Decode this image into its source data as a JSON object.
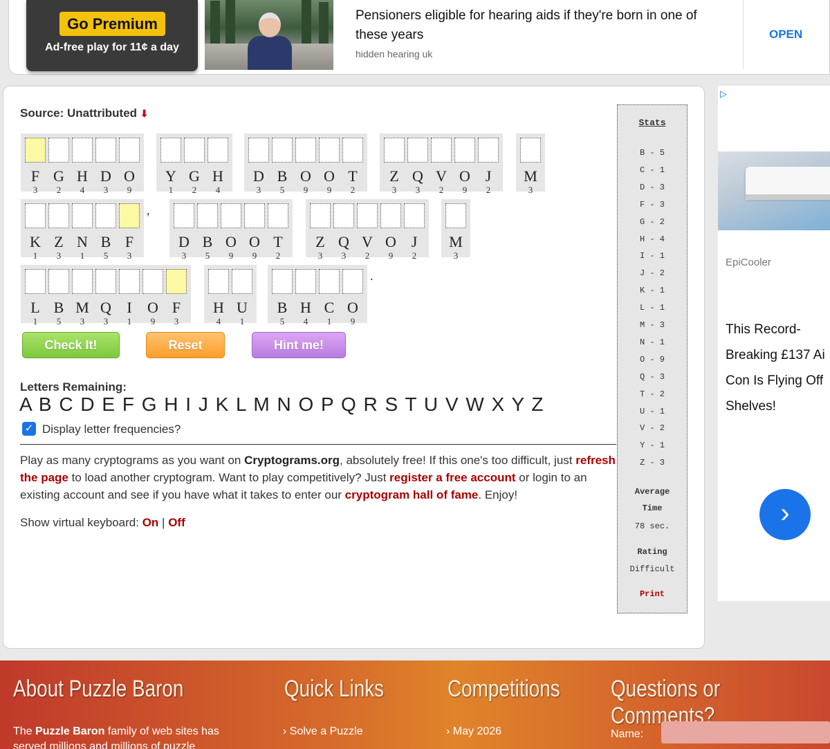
{
  "top_ad": {
    "premium_button": "Go Premium",
    "premium_sub": "Ad-free play for 11¢ a day",
    "headline": "Pensioners eligible for hearing aids if they're born in one of these years",
    "source": "hidden hearing uk",
    "open_label": "OPEN"
  },
  "puzzle": {
    "source_label": "Source: Unattributed",
    "source_arrow": "⬇",
    "rows": [
      [
        {
          "letters": [
            "F",
            "G",
            "H",
            "D",
            "O"
          ],
          "counts": [
            "3",
            "2",
            "4",
            "3",
            "9"
          ],
          "highlight": [
            0
          ]
        },
        {
          "letters": [
            "Y",
            "G",
            "H"
          ],
          "counts": [
            "1",
            "2",
            "4"
          ],
          "highlight": []
        },
        {
          "letters": [
            "D",
            "B",
            "O",
            "O",
            "T"
          ],
          "counts": [
            "3",
            "5",
            "9",
            "9",
            "2"
          ],
          "highlight": []
        },
        {
          "letters": [
            "Z",
            "Q",
            "V",
            "O",
            "J"
          ],
          "counts": [
            "3",
            "3",
            "2",
            "9",
            "2"
          ],
          "highlight": []
        },
        {
          "letters": [
            "M"
          ],
          "counts": [
            "3"
          ],
          "highlight": []
        }
      ],
      [
        {
          "letters": [
            "K",
            "Z",
            "N",
            "B",
            "F"
          ],
          "counts": [
            "1",
            "3",
            "1",
            "5",
            "3"
          ],
          "highlight": [
            4
          ],
          "punct": ","
        },
        {
          "letters": [
            "D",
            "B",
            "O",
            "O",
            "T"
          ],
          "counts": [
            "3",
            "5",
            "9",
            "9",
            "2"
          ],
          "highlight": []
        },
        {
          "letters": [
            "Z",
            "Q",
            "V",
            "O",
            "J"
          ],
          "counts": [
            "3",
            "3",
            "2",
            "9",
            "2"
          ],
          "highlight": []
        },
        {
          "letters": [
            "M"
          ],
          "counts": [
            "3"
          ],
          "highlight": []
        }
      ],
      [
        {
          "letters": [
            "L",
            "B",
            "M",
            "Q",
            "I",
            "O",
            "F"
          ],
          "counts": [
            "1",
            "5",
            "3",
            "3",
            "1",
            "9",
            "3"
          ],
          "highlight": [
            6
          ]
        },
        {
          "letters": [
            "H",
            "U"
          ],
          "counts": [
            "4",
            "1"
          ],
          "highlight": []
        },
        {
          "letters": [
            "B",
            "H",
            "C",
            "O"
          ],
          "counts": [
            "5",
            "4",
            "1",
            "9"
          ],
          "highlight": [],
          "punct": "."
        }
      ]
    ],
    "buttons": {
      "check": "Check It!",
      "reset": "Reset",
      "hint": "Hint me!"
    },
    "letters_remaining_label": "Letters Remaining:",
    "letters_remaining": "A B C D E F G H I J K L M N O P Q R S T U V W X Y Z",
    "display_freq_label": "Display letter frequencies?",
    "display_freq_checked": true
  },
  "info": {
    "p1": "Play as many cryptograms as you want on ",
    "site": "Cryptograms.org",
    "p2": ", absolutely free! If this one's too difficult, just ",
    "link_refresh": "refresh the page",
    "p3": " to load another cryptogram. Want to play competitively? Just ",
    "link_register": "register a free account",
    "p4": " or login to an existing account and see if you have what it takes to enter our ",
    "link_hof": "cryptogram hall of fame",
    "p5": ". Enjoy!",
    "vk_label": "Show virtual keyboard: ",
    "vk_on": "On",
    "vk_sep": " | ",
    "vk_off": "Off"
  },
  "stats": {
    "title": "Stats",
    "rows": [
      "B - 5",
      "C - 1",
      "D - 3",
      "F - 3",
      "G - 2",
      "H - 4",
      "I - 1",
      "J - 2",
      "K - 1",
      "L - 1",
      "M - 3",
      "N - 1",
      "O - 9",
      "Q - 3",
      "T - 2",
      "U - 1",
      "V - 2",
      "Y - 1",
      "Z - 3"
    ],
    "avg_label_1": "Average",
    "avg_label_2": "Time",
    "avg_value": "78 sec.",
    "rating_label": "Rating",
    "rating_value": "Difficult",
    "print": "Print"
  },
  "right_ad": {
    "adchoices": "▷",
    "brand": "EpiCooler",
    "headline_lines": [
      "This Record-",
      "Breaking £137 Ai",
      "Con Is Flying Off",
      "Shelves!"
    ],
    "go": "›"
  },
  "footer": {
    "about_title": "About Puzzle Baron",
    "about_text_1": "The ",
    "about_brand": "Puzzle Baron",
    "about_text_2": " family of web sites has served millions and millions of puzzle",
    "quick_title": "Quick Links",
    "quick_item": "› Solve a Puzzle",
    "comp_title": "Competitions",
    "comp_item": "› May 2026",
    "q_title": "Questions or Comments?",
    "name_label": "Name:"
  }
}
